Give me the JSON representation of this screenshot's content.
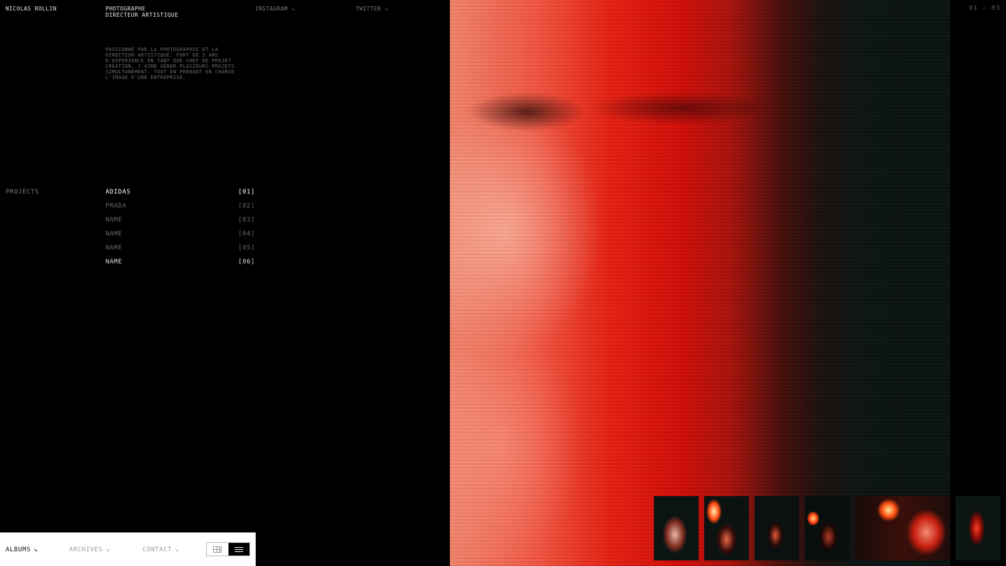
{
  "header": {
    "name": "NICOLAS ROLLIN",
    "roles": [
      "PHOTOGRAPHE",
      "DIRECTEUR ARTISTIQUE"
    ],
    "links": [
      {
        "label": "INSTAGRAM ↘"
      },
      {
        "label": "TWITTER ↘"
      }
    ],
    "counter": "01 — 03"
  },
  "bio": "PASSIONNÉ PAR LA PHOTOGRAPHIE ET LA DIRECTION ARTISTIQUE. FORT DE 3 ANS D'EXPÉRIENCE EN TANT QUE CHEF DE PROJET CRÉATION, J'AIME GÉRER PLUSIEURS PROJETS SIMULTANÉMENT. TOUT EN PRENANT EN CHARGE L'IMAGE D'UNE ENTREPRISE.",
  "projects": {
    "label": "PROJECTS",
    "items": [
      {
        "name": "ADIDAS",
        "index": "[01]"
      },
      {
        "name": "PRADA",
        "index": "[02]"
      },
      {
        "name": "NAME",
        "index": "[03]"
      },
      {
        "name": "NAME",
        "index": "[04]"
      },
      {
        "name": "NAME",
        "index": "[05]"
      },
      {
        "name": "NAME",
        "index": "[06]"
      }
    ]
  },
  "bottom_nav": {
    "items": [
      {
        "label": "ALBUMS",
        "arrow": "↘"
      },
      {
        "label": "ARCHIVES",
        "arrow": "↘"
      },
      {
        "label": "CONTACT",
        "arrow": "↘"
      }
    ],
    "view_icons": [
      "grid-icon",
      "list-icon"
    ]
  },
  "colors": {
    "background": "#000000",
    "accent_red": "#e52012",
    "dark_teal": "#0a1311"
  }
}
